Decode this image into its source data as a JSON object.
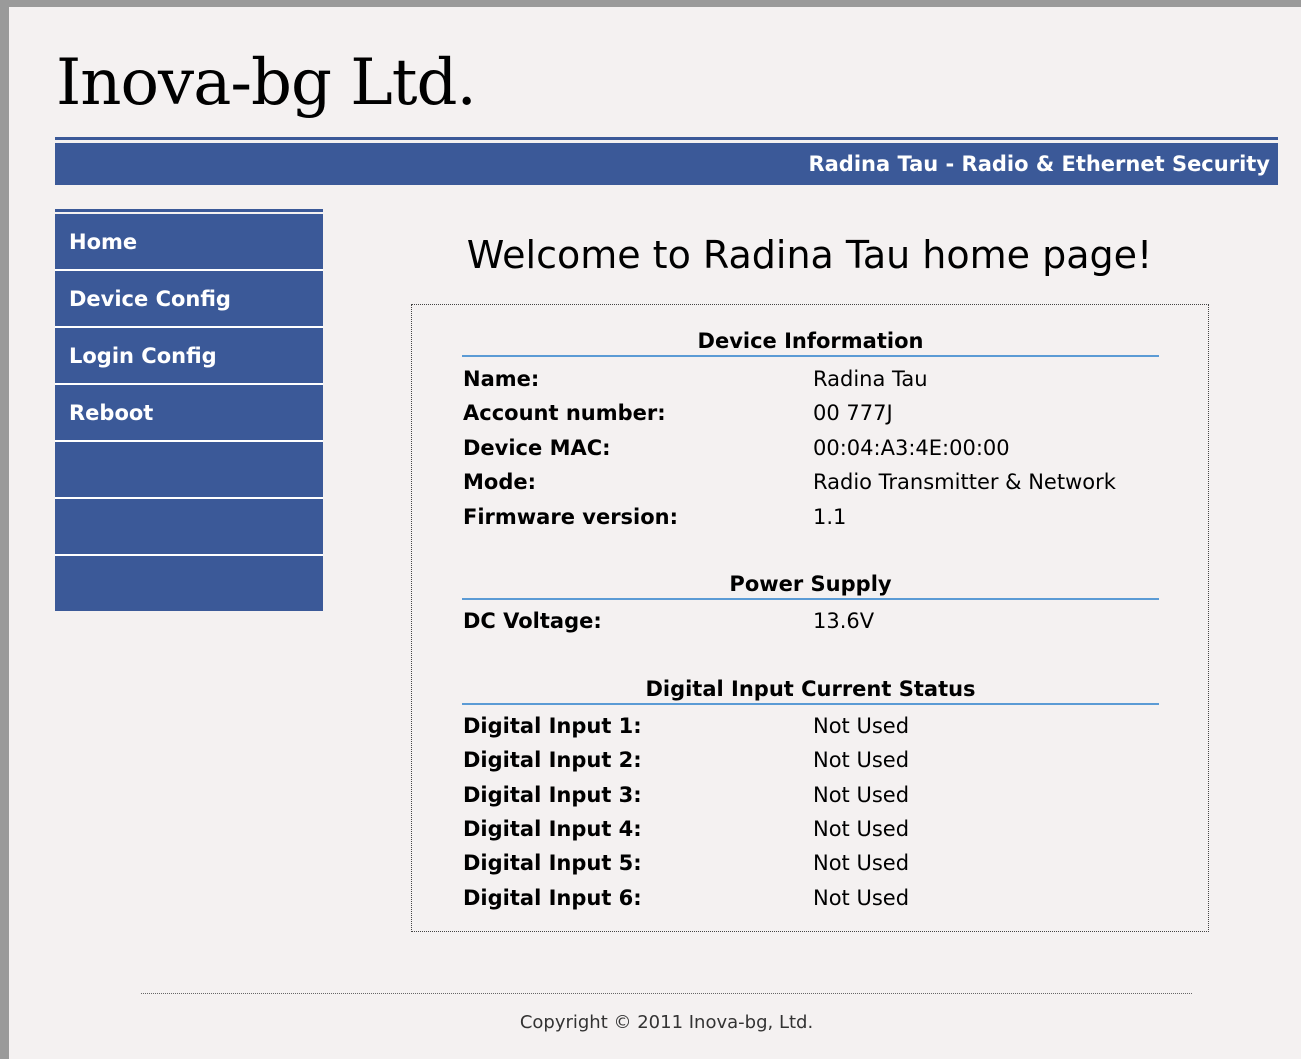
{
  "header": {
    "logo": "Inova-bg Ltd.",
    "banner": "Radina Tau - Radio & Ethernet Security"
  },
  "nav": {
    "items": [
      {
        "label": "Home"
      },
      {
        "label": "Device Config"
      },
      {
        "label": "Login Config"
      },
      {
        "label": "Reboot"
      },
      {
        "label": ""
      },
      {
        "label": ""
      },
      {
        "label": ""
      }
    ]
  },
  "main": {
    "title": "Welcome to Radina Tau home page!",
    "device_info": {
      "title": "Device Information",
      "rows": [
        {
          "label": "Name:",
          "value": "Radina Tau"
        },
        {
          "label": "Account number:",
          "value": "00 777J"
        },
        {
          "label": "Device MAC:",
          "value": "00:04:A3:4E:00:00"
        },
        {
          "label": "Mode:",
          "value": "Radio Transmitter & Network"
        },
        {
          "label": "Firmware version:",
          "value": "1.1"
        }
      ]
    },
    "power": {
      "title": "Power Supply",
      "rows": [
        {
          "label": "DC Voltage:",
          "value": "13.6V"
        }
      ]
    },
    "inputs": {
      "title": "Digital Input Current Status",
      "rows": [
        {
          "label": "Digital Input 1:",
          "value": "Not Used"
        },
        {
          "label": "Digital Input 2:",
          "value": "Not Used"
        },
        {
          "label": "Digital Input 3:",
          "value": "Not Used"
        },
        {
          "label": "Digital Input 4:",
          "value": "Not Used"
        },
        {
          "label": "Digital Input 5:",
          "value": "Not Used"
        },
        {
          "label": "Digital Input 6:",
          "value": "Not Used"
        }
      ]
    }
  },
  "footer": {
    "copyright": "Copyright © 2011 Inova-bg, Ltd."
  },
  "colors": {
    "brand": "#3b5998",
    "section_rule": "#5b9bd5",
    "background": "#f4f1f1"
  }
}
